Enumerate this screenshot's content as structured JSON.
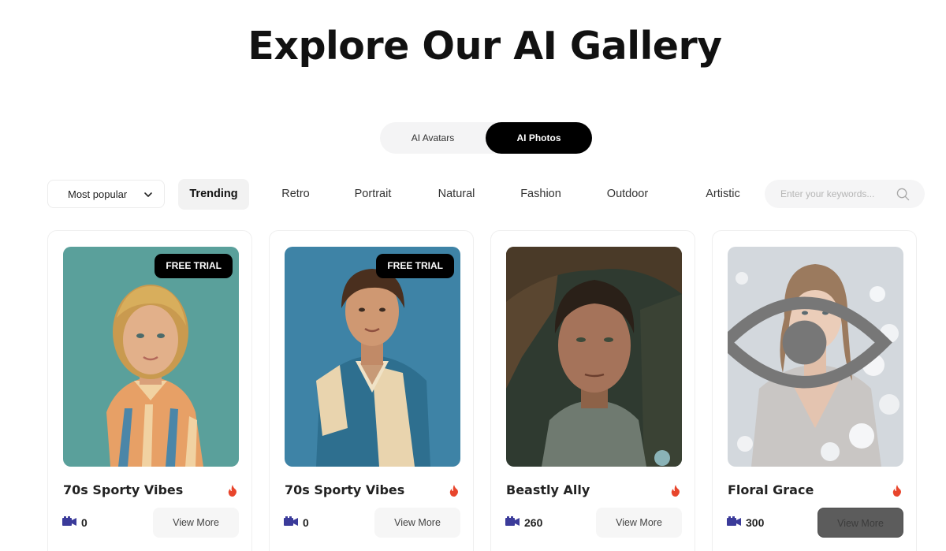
{
  "page": {
    "title": "Explore Our AI Gallery"
  },
  "mode_tabs": [
    {
      "label": "AI Avatars",
      "active": false
    },
    {
      "label": "AI Photos",
      "active": true
    }
  ],
  "filters": {
    "sort": {
      "selected": "Most popular"
    },
    "categories": [
      {
        "label": "Trending",
        "active": true
      },
      {
        "label": "Retro",
        "active": false
      },
      {
        "label": "Portrait",
        "active": false
      },
      {
        "label": "Natural",
        "active": false
      },
      {
        "label": "Fashion",
        "active": false
      },
      {
        "label": "Outdoor",
        "active": false
      },
      {
        "label": "Artistic",
        "active": false
      }
    ],
    "search": {
      "placeholder": "Enter your keywords...",
      "value": ""
    }
  },
  "cards": [
    {
      "title": "70s Sporty Vibes",
      "badge": "FREE TRIAL",
      "count": "0",
      "button": "View More",
      "hot": true
    },
    {
      "title": "70s Sporty Vibes",
      "badge": "FREE TRIAL",
      "count": "0",
      "button": "View More",
      "hot": true
    },
    {
      "title": "Beastly Ally",
      "badge": "",
      "count": "260",
      "button": "View More",
      "hot": true
    },
    {
      "title": "Floral Grace",
      "badge": "",
      "count": "300",
      "button": "View More",
      "hot": true
    }
  ],
  "colors": {
    "accent": "#000000",
    "fire": "#e8452c",
    "count_icon": "#3b3b9a"
  },
  "icons": [
    "chevron-down-icon",
    "search-icon",
    "fire-icon",
    "film-icon",
    "eye-icon"
  ]
}
